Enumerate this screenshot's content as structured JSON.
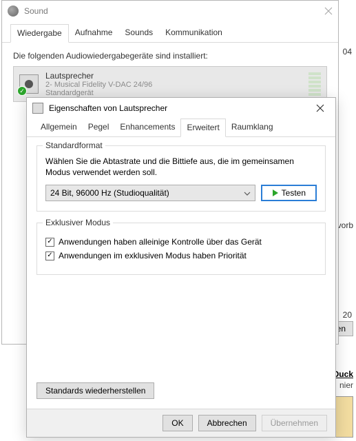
{
  "sound": {
    "title": "Sound",
    "tabs": [
      "Wiedergabe",
      "Aufnahme",
      "Sounds",
      "Kommunikation"
    ],
    "selected_tab": 0,
    "instruction": "Die folgenden Audiowiedergabegeräte sind installiert:",
    "device": {
      "name": "Lautsprecher",
      "desc": "2- Musical Fidelity V-DAC 24/96",
      "status": "Standardgerät"
    }
  },
  "props": {
    "title": "Eigenschaften von Lautsprecher",
    "tabs": [
      "Allgemein",
      "Pegel",
      "Enhancements",
      "Erweitert",
      "Raumklang"
    ],
    "selected_tab": 3,
    "standard": {
      "legend": "Standardformat",
      "desc": "Wählen Sie die Abtastrate und die Bittiefe aus, die im gemeinsamen Modus verwendet werden soll.",
      "value": "24 Bit, 96000 Hz (Studioqualität)",
      "test": "Testen"
    },
    "exclusive": {
      "legend": "Exklusiver Modus",
      "opt1": "Anwendungen haben alleinige Kontrolle über das Gerät",
      "opt2": "Anwendungen im exklusiven Modus haben Priorität"
    },
    "restore": "Standards wiederherstellen",
    "ok": "OK",
    "cancel": "Abbrechen",
    "apply": "Übernehmen"
  },
  "bg": {
    "t1": "04",
    "t2": "al vorb",
    "t3": "20",
    "btn": "ehmen",
    "link": "sDuck",
    "sub": "nier"
  }
}
